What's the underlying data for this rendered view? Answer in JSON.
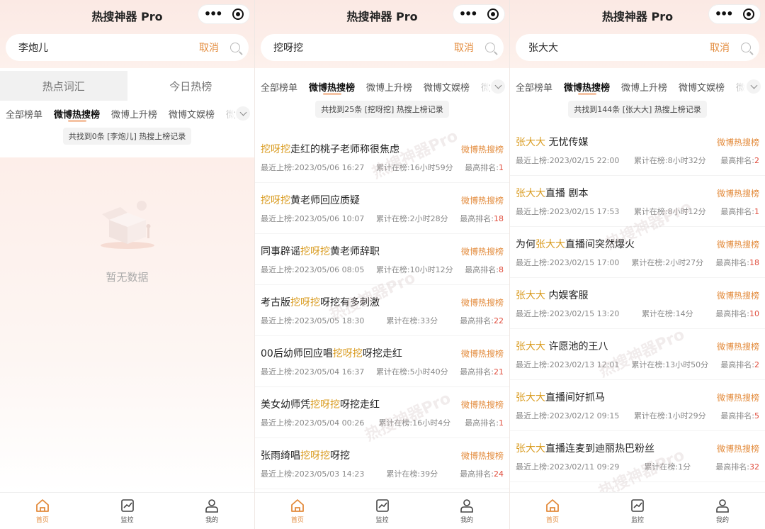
{
  "app": {
    "title": "热搜神器 Pro",
    "accent": "#e38b3c",
    "highlight": "#d99b1f",
    "rank_color": "#e04d3d",
    "watermark": "热搜神器Pro"
  },
  "labels": {
    "cancel": "取消",
    "src": "微博热搜榜",
    "last_prefix": "最近上榜:",
    "dur_prefix": "累计在榜:",
    "rank_prefix": "最高排名:"
  },
  "tabs": [
    "全部榜单",
    "微博热搜榜",
    "微博上升榜",
    "微博文娱榜",
    "微"
  ],
  "tabbar": [
    {
      "label": "首页",
      "icon": "home-icon"
    },
    {
      "label": "监控",
      "icon": "chart-icon"
    },
    {
      "label": "我的",
      "icon": "user-icon"
    }
  ],
  "panel1": {
    "query": "李炮儿",
    "seg": [
      "热点词汇",
      "今日热榜"
    ],
    "count": "共找到0条 [李炮儿] 热搜上榜记录",
    "empty": "暂无数据"
  },
  "panel2": {
    "query": "挖呀挖",
    "count": "共找到25条 [挖呀挖] 热搜上榜记录",
    "items": [
      {
        "pre": "",
        "hl": "挖呀挖",
        "post": "走红的桃子老师称很焦虑",
        "last": "2023/05/06 16:27",
        "dur": "16小时59分",
        "rank": "1"
      },
      {
        "pre": "",
        "hl": "挖呀挖",
        "post": "黄老师回应质疑",
        "last": "2023/05/06 10:07",
        "dur": "2小时28分",
        "rank": "18"
      },
      {
        "pre": "同事辟谣",
        "hl": "挖呀挖",
        "post": "黄老师辞职",
        "last": "2023/05/06 08:05",
        "dur": "10小时12分",
        "rank": "8"
      },
      {
        "pre": "考古版",
        "hl": "挖呀挖",
        "post": "呀挖有多刺激",
        "last": "2023/05/05 18:30",
        "dur": "33分",
        "rank": "22"
      },
      {
        "pre": "00后幼师回应唱",
        "hl": "挖呀挖",
        "post": "呀挖走红",
        "last": "2023/05/04 16:37",
        "dur": "5小时40分",
        "rank": "21"
      },
      {
        "pre": "美女幼师凭",
        "hl": "挖呀挖",
        "post": "呀挖走红",
        "last": "2023/05/04 00:26",
        "dur": "16小时4分",
        "rank": "1"
      },
      {
        "pre": "张雨绮唱",
        "hl": "挖呀挖",
        "post": "呀挖",
        "last": "2023/05/03 14:23",
        "dur": "39分",
        "rank": "24"
      }
    ]
  },
  "panel3": {
    "query": "张大大",
    "count": "共找到144条 [张大大] 热搜上榜记录",
    "items": [
      {
        "pre": "",
        "hl": "张大大",
        "post": " 无忧传媒",
        "last": "2023/02/15 22:00",
        "dur": "8小时32分",
        "rank": "2"
      },
      {
        "pre": "",
        "hl": "张大大",
        "post": "直播 剧本",
        "last": "2023/02/15 17:53",
        "dur": "8小时12分",
        "rank": "1"
      },
      {
        "pre": "为何",
        "hl": "张大大",
        "post": "直播间突然爆火",
        "last": "2023/02/15 17:00",
        "dur": "2小时27分",
        "rank": "18"
      },
      {
        "pre": "",
        "hl": "张大大",
        "post": " 内娱客服",
        "last": "2023/02/15 13:20",
        "dur": "14分",
        "rank": "10"
      },
      {
        "pre": "",
        "hl": "张大大",
        "post": " 许愿池的王八",
        "last": "2023/02/13 12:01",
        "dur": "13小时50分",
        "rank": "2"
      },
      {
        "pre": "",
        "hl": "张大大",
        "post": "直播间好抓马",
        "last": "2023/02/12 09:15",
        "dur": "1小时29分",
        "rank": "5"
      },
      {
        "pre": "",
        "hl": "张大大",
        "post": "直播连麦到迪丽热巴粉丝",
        "last": "2023/02/11 09:29",
        "dur": "1分",
        "rank": "32"
      }
    ]
  }
}
